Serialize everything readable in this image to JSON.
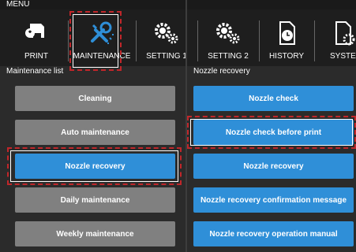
{
  "menu_title": "MENU",
  "toolbar": [
    {
      "label": "PRINT",
      "icon": "print-icon"
    },
    {
      "label": "MAINTENANCE",
      "icon": "tools-icon"
    },
    {
      "label": "SETTING 1",
      "icon": "gears-icon"
    },
    {
      "label": "SETTING 2",
      "icon": "gears-icon"
    },
    {
      "label": "HISTORY",
      "icon": "history-icon"
    },
    {
      "label": "SYSTEM",
      "icon": "system-icon"
    }
  ],
  "left_panel": {
    "title": "Maintenance list",
    "items": [
      {
        "label": "Cleaning"
      },
      {
        "label": "Auto maintenance"
      },
      {
        "label": "Nozzle recovery"
      },
      {
        "label": "Daily maintenance"
      },
      {
        "label": "Weekly maintenance"
      }
    ]
  },
  "right_panel": {
    "title": "Nozzle recovery",
    "items": [
      {
        "label": "Nozzle check"
      },
      {
        "label": "Nozzle check before print"
      },
      {
        "label": "Nozzle recovery"
      },
      {
        "label": "Nozzle recovery confirmation message"
      },
      {
        "label": "Nozzle recovery operation manual"
      }
    ]
  },
  "colors": {
    "button_blue": "#2f8fd8",
    "button_gray": "#808080",
    "highlight_red": "#c0262a"
  }
}
